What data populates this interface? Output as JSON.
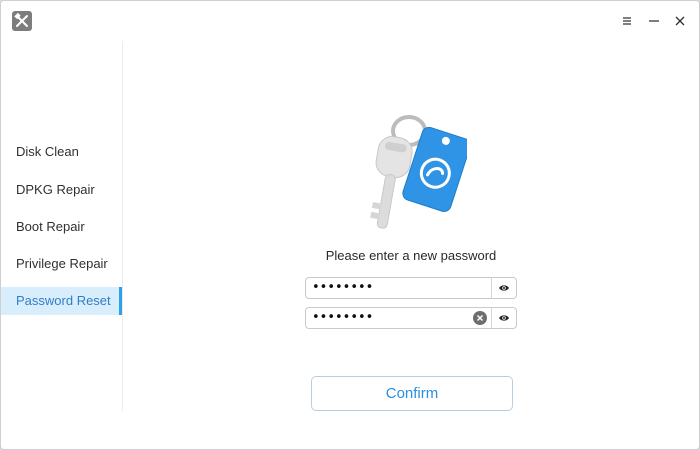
{
  "window": {
    "icons": {
      "app": "tools-icon",
      "menu": "menu-icon",
      "minimize": "minimize-icon",
      "close": "close-icon"
    }
  },
  "sidebar": {
    "items": [
      {
        "label": "Disk Clean",
        "active": false
      },
      {
        "label": "DPKG Repair",
        "active": false
      },
      {
        "label": "Boot Repair",
        "active": false
      },
      {
        "label": "Privilege Repair",
        "active": false
      },
      {
        "label": "Password Reset",
        "active": true
      }
    ]
  },
  "main": {
    "illustration": "key-with-deepin-tag-icon",
    "prompt": "Please enter a new password",
    "password": {
      "value": "••••••••",
      "reveal_icon": "eye-icon"
    },
    "confirm_password": {
      "value": "••••••••",
      "clear_icon": "clear-icon",
      "reveal_icon": "eye-icon"
    },
    "confirm_label": "Confirm"
  },
  "colors": {
    "accent": "#2ea0e8",
    "active_bg": "#d9eefc",
    "tag_blue": "#2f94e6"
  }
}
